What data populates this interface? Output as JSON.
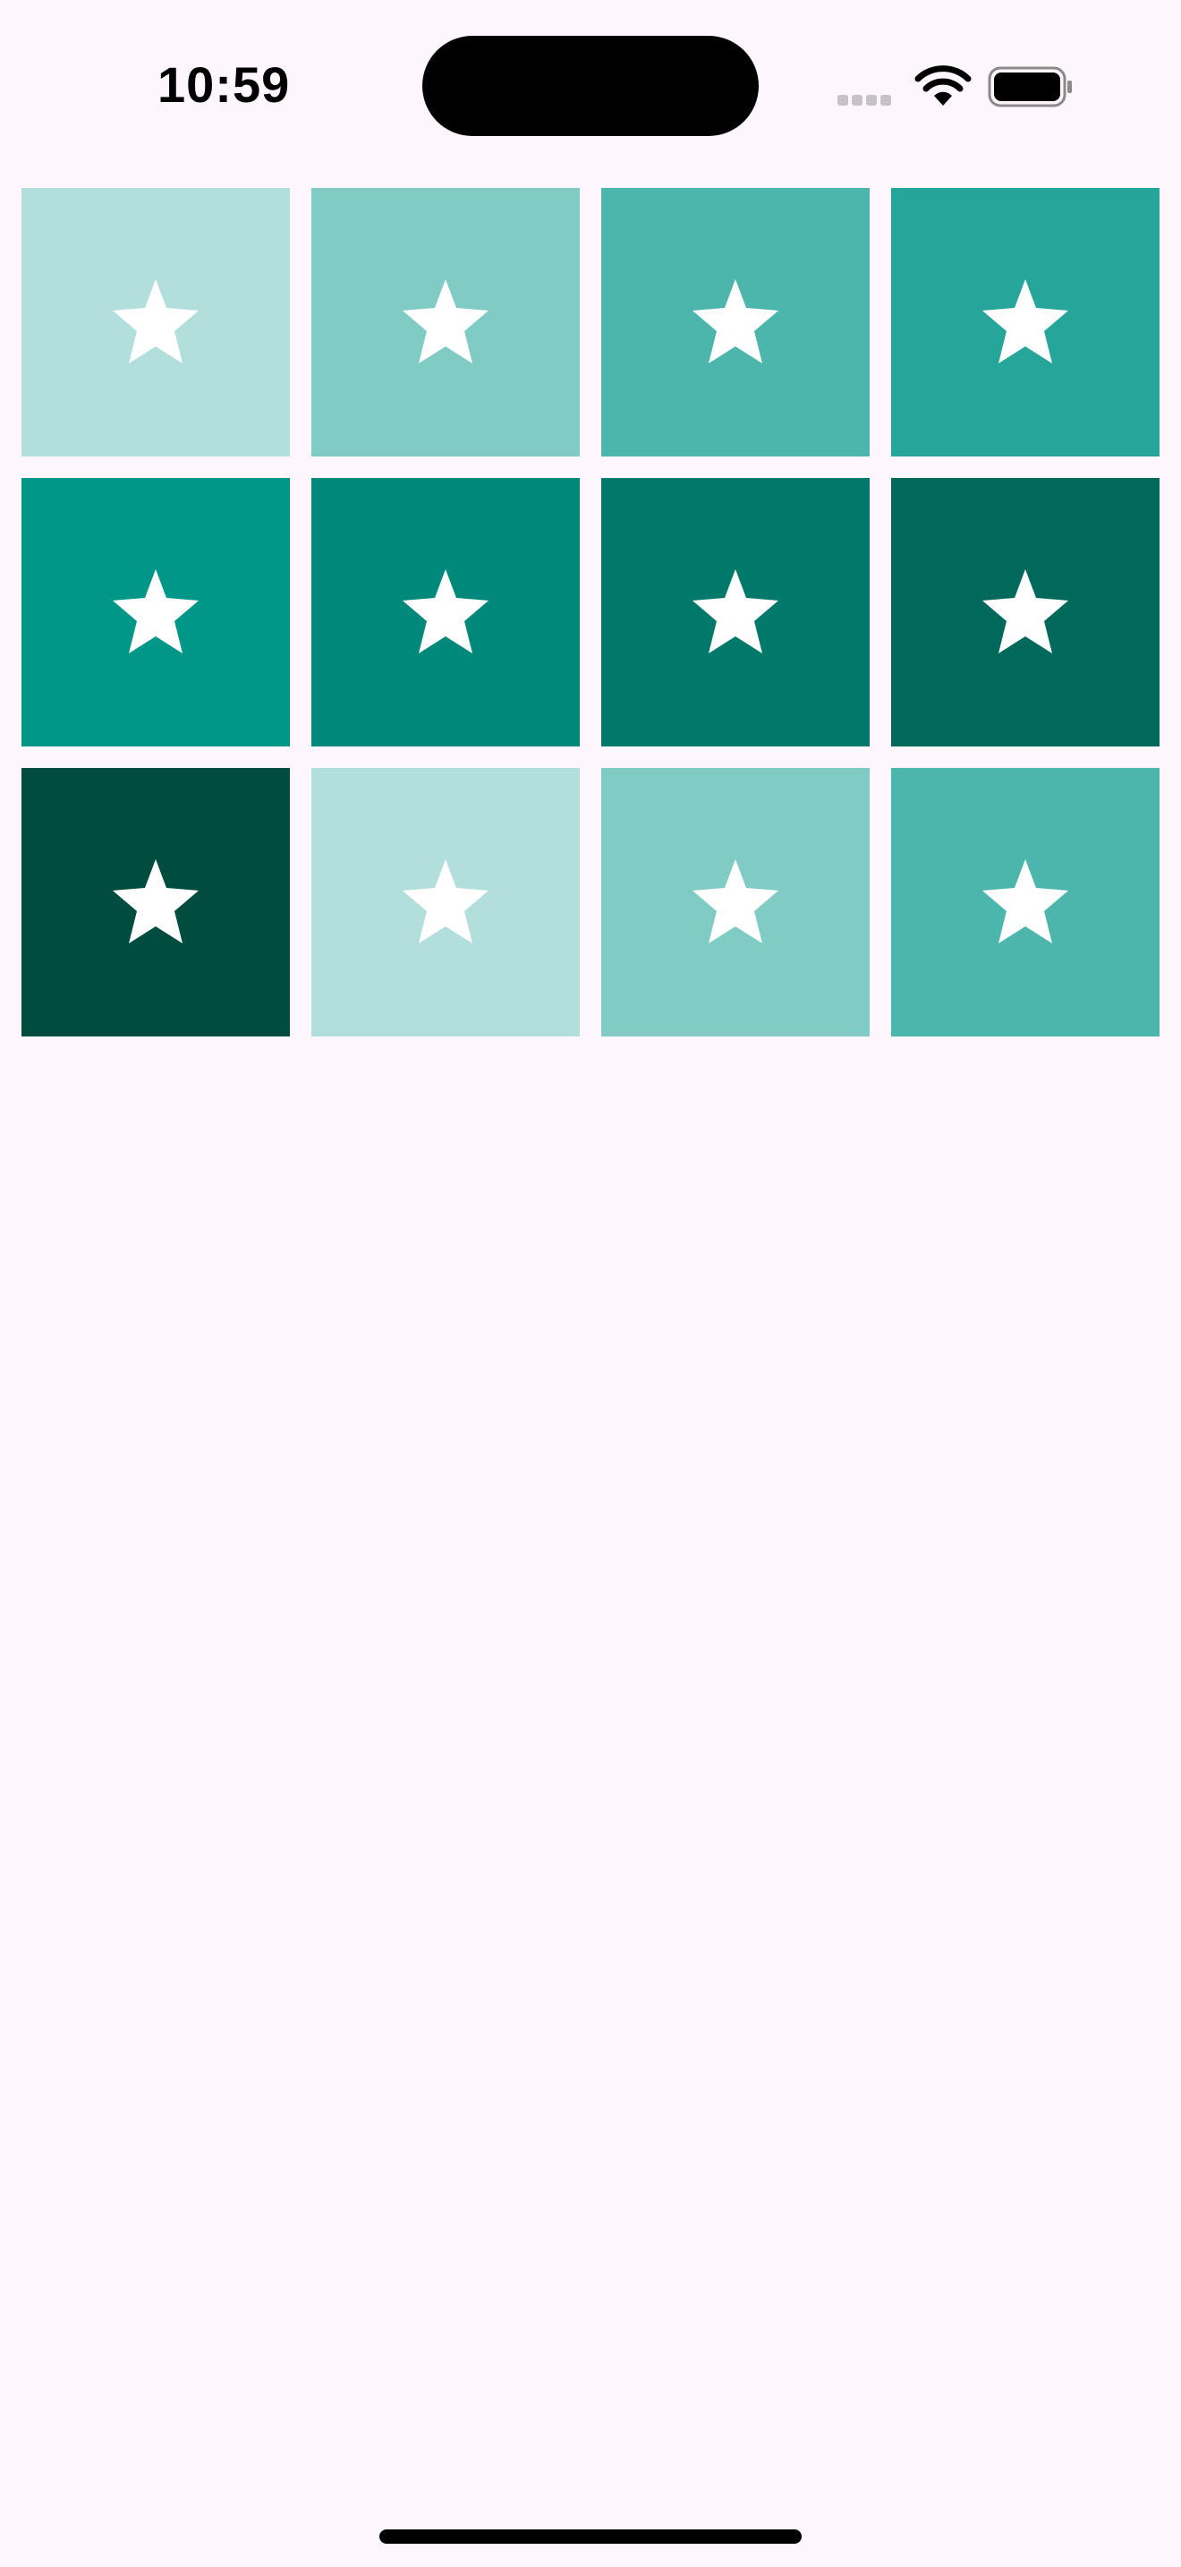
{
  "status_bar": {
    "time": "10:59"
  },
  "colors": {
    "background": "#fdf6fd",
    "star": "#ffffff"
  },
  "tiles": [
    {
      "color": "#b2dfdb",
      "icon": "star-icon"
    },
    {
      "color": "#80cbc4",
      "icon": "star-icon"
    },
    {
      "color": "#4db6ac",
      "icon": "star-icon"
    },
    {
      "color": "#26a69a",
      "icon": "star-icon"
    },
    {
      "color": "#009688",
      "icon": "star-icon"
    },
    {
      "color": "#00897b",
      "icon": "star-icon"
    },
    {
      "color": "#00796b",
      "icon": "star-icon"
    },
    {
      "color": "#00695c",
      "icon": "star-icon"
    },
    {
      "color": "#004d40",
      "icon": "star-icon"
    },
    {
      "color": "#b2dfdb",
      "icon": "star-icon"
    },
    {
      "color": "#80cbc4",
      "icon": "star-icon"
    },
    {
      "color": "#4db6ac",
      "icon": "star-icon"
    }
  ]
}
